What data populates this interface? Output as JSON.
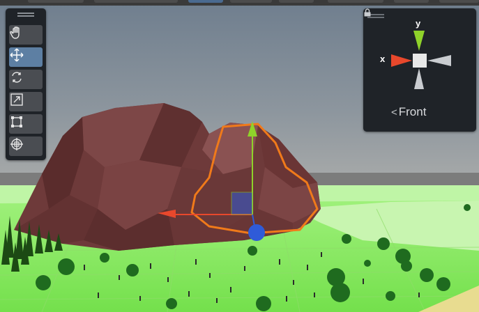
{
  "scene_view": {
    "toolbox": {
      "tools": [
        {
          "name": "hand-tool",
          "icon": "hand-icon"
        },
        {
          "name": "move-tool",
          "icon": "move-icon",
          "active": true
        },
        {
          "name": "rotate-tool",
          "icon": "rotate-icon"
        },
        {
          "name": "scale-tool",
          "icon": "scale-icon"
        },
        {
          "name": "rect-tool",
          "icon": "rect-icon"
        },
        {
          "name": "transform-tool",
          "icon": "transform-icon"
        }
      ]
    },
    "orientation_gizmo": {
      "y_label": "y",
      "x_label": "x",
      "view_name": "Front",
      "lock_icon": "lock-icon"
    },
    "colors": {
      "x_axis": "#e8482c",
      "y_axis": "#8fd22a",
      "z_axis": "#2f5bd8",
      "selection_outline": "#f07a1a",
      "grass": "#86e85e",
      "mountain": "#6e3a3a",
      "tree": "#1f6b1f"
    }
  }
}
